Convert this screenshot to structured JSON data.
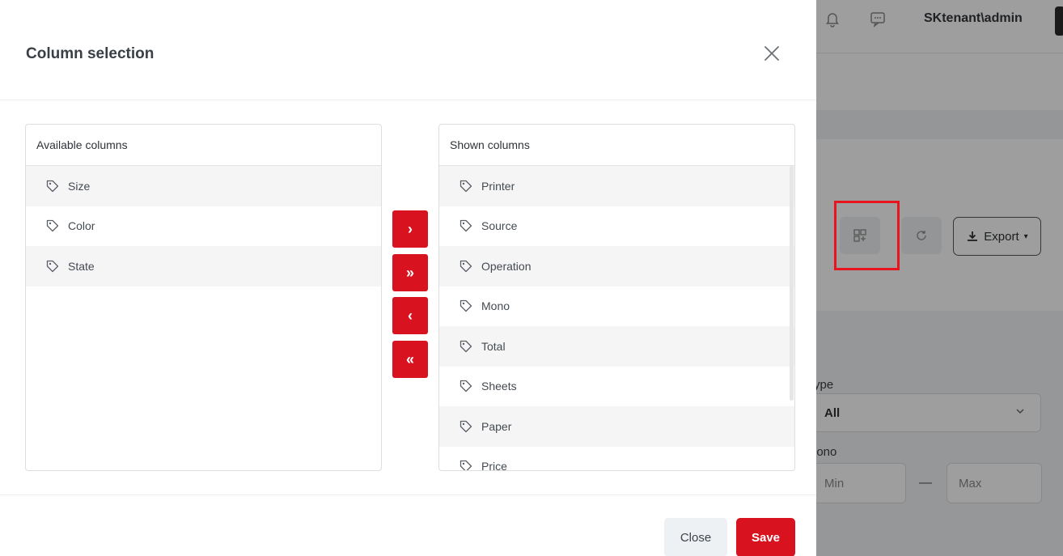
{
  "modal": {
    "title": "Column selection",
    "available": {
      "header": "Available columns",
      "items": [
        "Size",
        "Color",
        "State"
      ]
    },
    "shown": {
      "header": "Shown columns",
      "items": [
        "Printer",
        "Source",
        "Operation",
        "Mono",
        "Total",
        "Sheets",
        "Paper",
        "Price"
      ]
    },
    "transfer_buttons": {
      "move_right": "›",
      "move_all_right": "»",
      "move_left": "‹",
      "move_all_left": "«"
    },
    "footer": {
      "close_label": "Close",
      "save_label": "Save"
    }
  },
  "background": {
    "user": "SKtenant\\admin",
    "export_label": "Export",
    "type_label": "ype",
    "type_value": "All",
    "mono_label": "lono",
    "min_placeholder": "Min",
    "max_placeholder": "Max",
    "range_separator": "—"
  },
  "colors": {
    "accent": "#d8121f",
    "highlight": "#e8141e"
  },
  "icons": {
    "item": "tag-icon",
    "close": "close-icon"
  }
}
